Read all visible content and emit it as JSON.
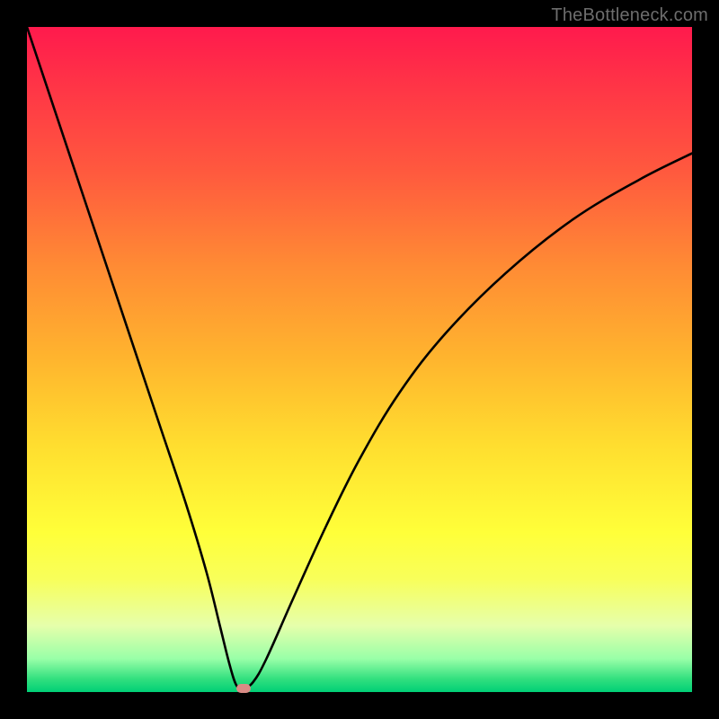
{
  "watermark": "TheBottleneck.com",
  "chart_data": {
    "type": "line",
    "title": "",
    "xlabel": "",
    "ylabel": "",
    "xlim": [
      0,
      100
    ],
    "ylim": [
      0,
      100
    ],
    "grid": false,
    "legend": false,
    "series": [
      {
        "name": "bottleneck-curve",
        "color": "#000000",
        "x": [
          0,
          4,
          8,
          12,
          16,
          20,
          24,
          27,
          29,
          30.5,
          31.5,
          32.5,
          34,
          36,
          40,
          45,
          50,
          56,
          63,
          72,
          82,
          92,
          100
        ],
        "y": [
          100,
          88,
          76,
          64,
          52,
          40,
          28,
          18,
          10,
          4,
          1,
          0.5,
          1.5,
          5,
          14,
          25,
          35,
          45,
          54,
          63,
          71,
          77,
          81
        ]
      }
    ],
    "annotations": [
      {
        "name": "min-marker",
        "x": 32.5,
        "y": 0.5,
        "color": "#d98b85"
      }
    ],
    "background_gradient": {
      "direction": "vertical",
      "stops": [
        {
          "pos": 0.0,
          "color": "#ff1a4d"
        },
        {
          "pos": 0.22,
          "color": "#ff5a3e"
        },
        {
          "pos": 0.5,
          "color": "#ffb52e"
        },
        {
          "pos": 0.76,
          "color": "#ffff39"
        },
        {
          "pos": 0.95,
          "color": "#99ffa8"
        },
        {
          "pos": 1.0,
          "color": "#00cf76"
        }
      ]
    }
  }
}
